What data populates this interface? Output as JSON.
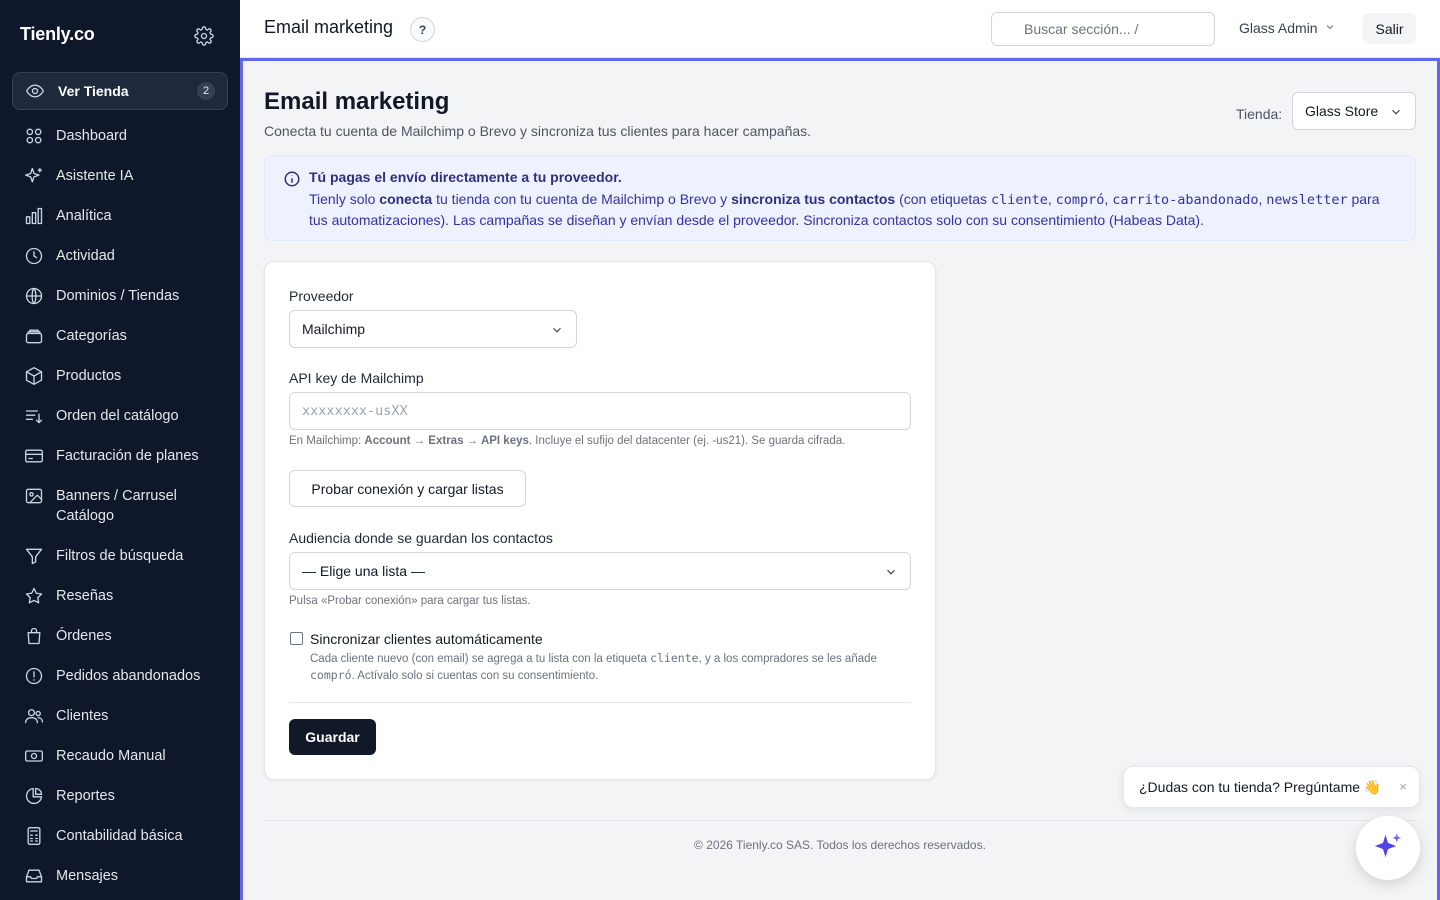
{
  "sidebar": {
    "brand": "Tienly.co",
    "ver_tienda": {
      "label": "Ver Tienda",
      "count": "2"
    },
    "items": [
      {
        "label": "Dashboard",
        "icon": "dashboard-icon"
      },
      {
        "label": "Asistente IA",
        "icon": "sparkles-icon"
      },
      {
        "label": "Analítica",
        "icon": "bar-chart-icon"
      },
      {
        "label": "Actividad",
        "icon": "clock-icon"
      },
      {
        "label": "Dominios / Tiendas",
        "icon": "globe-icon"
      },
      {
        "label": "Categorías",
        "icon": "layers-icon"
      },
      {
        "label": "Productos",
        "icon": "box-icon"
      },
      {
        "label": "Orden del catálogo",
        "icon": "sort-list-icon"
      },
      {
        "label": "Facturación de planes",
        "icon": "credit-card-icon"
      },
      {
        "label": "Banners / Carrusel Catálogo",
        "icon": "image-icon"
      },
      {
        "label": "Filtros de búsqueda",
        "icon": "filter-icon"
      },
      {
        "label": "Reseñas",
        "icon": "star-icon"
      },
      {
        "label": "Órdenes",
        "icon": "shopping-bag-icon"
      },
      {
        "label": "Pedidos abandonados",
        "icon": "alert-circle-icon"
      },
      {
        "label": "Clientes",
        "icon": "users-icon"
      },
      {
        "label": "Recaudo Manual",
        "icon": "cash-icon"
      },
      {
        "label": "Reportes",
        "icon": "pie-chart-icon"
      },
      {
        "label": "Contabilidad básica",
        "icon": "calculator-icon"
      },
      {
        "label": "Mensajes",
        "icon": "inbox-icon"
      }
    ]
  },
  "topbar": {
    "title": "Email marketing",
    "help": "?",
    "search_placeholder": "Buscar sección...  /",
    "user": "Glass Admin",
    "logout": "Salir"
  },
  "page": {
    "title": "Email marketing",
    "subtitle": "Conecta tu cuenta de Mailchimp o Brevo y sincroniza tus clientes para hacer campañas.",
    "store_label": "Tienda:",
    "store_value": "Glass Store"
  },
  "info": {
    "title": "Tú pagas el envío directamente a tu proveedor.",
    "t1": "Tienly solo ",
    "b1": "conecta",
    "t2": " tu tienda con tu cuenta de Mailchimp o Brevo y ",
    "b2": "sincroniza tus contactos",
    "t3": " (con etiquetas ",
    "tag1": "cliente",
    "sep1": ", ",
    "tag2": "compró",
    "sep2": ", ",
    "tag3": "carrito-abandonado",
    "sep3": ", ",
    "tag4": "newsletter",
    "t4": " para tus automatizaciones). Las campañas se diseñan y envían desde el proveedor. Sincroniza contactos solo con su consentimiento (Habeas Data)."
  },
  "form": {
    "provider_label": "Proveedor",
    "provider_value": "Mailchimp",
    "api_label": "API key de Mailchimp",
    "api_placeholder": "xxxxxxxx-usXX",
    "api_hint_1": "En Mailchimp: ",
    "api_hint_path": "Account → Extras → API keys",
    "api_hint_2": ". Incluye el sufijo del datacenter (ej. -us21). Se guarda cifrada.",
    "test_button": "Probar conexión y cargar listas",
    "audience_label": "Audiencia donde se guardan los contactos",
    "audience_value": "— Elige una lista —",
    "audience_hint": "Pulsa «Probar conexión» para cargar tus listas.",
    "sync_label": "Sincronizar clientes automáticamente",
    "sync_desc_1": "Cada cliente nuevo (con email) se agrega a tu lista con la etiqueta ",
    "sync_tag1": "cliente",
    "sync_desc_2": ", y a los compradores se les añade ",
    "sync_tag2": "compró",
    "sync_desc_3": ". Actívalo solo si cuentas con su consentimiento.",
    "save_button": "Guardar"
  },
  "footer": "© 2026 Tienly.co SAS. Todos los derechos reservados.",
  "chat": {
    "bubble": "¿Dudas con tu tienda? Pregúntame 👋",
    "close": "×"
  },
  "colors": {
    "sidebar_bg": "#0f172a",
    "accent_border": "#6366f1",
    "info_bg": "#eef2ff",
    "primary_button": "#111827"
  }
}
